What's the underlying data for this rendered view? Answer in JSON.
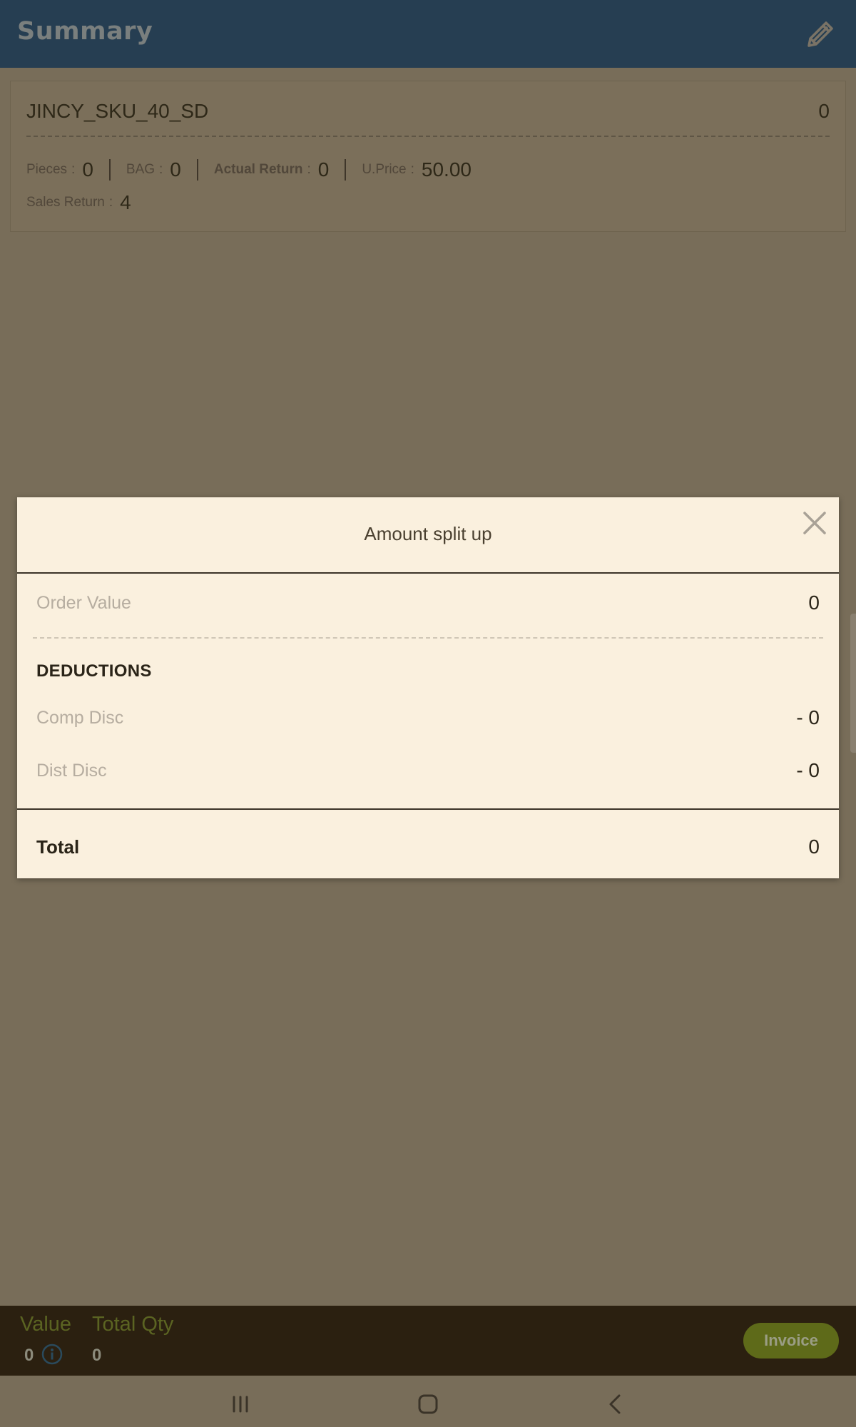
{
  "header": {
    "title": "Summary",
    "edit_icon": "pencil-icon"
  },
  "product": {
    "sku": "JINCY_SKU_40_SD",
    "qty": "0",
    "pieces_label": "Pieces",
    "pieces_value": "0",
    "bag_label": "BAG",
    "bag_value": "0",
    "actual_return_label": "Actual Return",
    "actual_return_value": "0",
    "uprice_label": "U.Price",
    "uprice_value": "50.00",
    "sales_return_label": "Sales Return",
    "sales_return_value": "4",
    "colon": ":"
  },
  "modal": {
    "title": "Amount split up",
    "order_value_label": "Order Value",
    "order_value": "0",
    "deductions_label": "DEDUCTIONS",
    "comp_disc_label": "Comp Disc",
    "comp_disc_value": "- 0",
    "dist_disc_label": "Dist Disc",
    "dist_disc_value": "- 0",
    "total_label": "Total",
    "total_value": "0"
  },
  "bottom_bar": {
    "value_label": "Value",
    "value": "0",
    "total_qty_label": "Total Qty",
    "total_qty": "0",
    "invoice_label": "Invoice"
  },
  "colors": {
    "header_bg": "#263e52",
    "overlay_bg": "#786d59",
    "modal_bg": "#faf0de",
    "invoice_bg": "#5e6a19"
  }
}
